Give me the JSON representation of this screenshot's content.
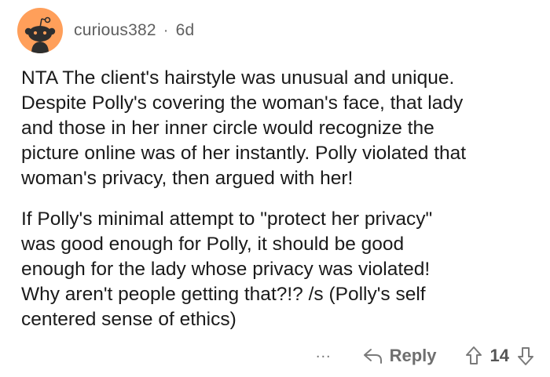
{
  "comment": {
    "author": "curious382",
    "separator": "·",
    "age": "6d",
    "paragraphs": [
      "NTA The client's hairstyle was unusual and unique.\nDespite Polly's covering the woman's face, that lady\nand those in her inner circle would recognize the\npicture online was of her instantly. Polly violated that\nwoman's privacy, then argued with her!",
      "If Polly's minimal attempt to \"protect her privacy\"\nwas good enough for Polly, it should be good\nenough for the lady whose privacy was violated!\nWhy aren't people getting that?!? /s (Polly's self\ncentered sense of ethics)"
    ]
  },
  "actions": {
    "more_label": "...",
    "reply_label": "Reply",
    "vote_count": "14"
  },
  "icons": {
    "avatar": "reddit-snoo-avatar-icon",
    "reply": "reply-arrow-icon",
    "upvote": "upvote-arrow-icon",
    "downvote": "downvote-arrow-icon"
  },
  "colors": {
    "avatar_bg": "#ff9f5a",
    "meta_text": "#5f5f5f",
    "body_text": "#1a1a1a",
    "action_text": "#6f6f6f"
  }
}
